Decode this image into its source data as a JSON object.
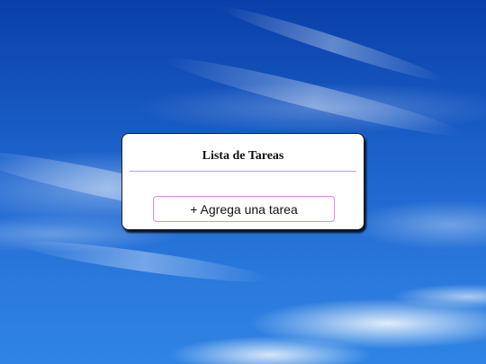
{
  "card": {
    "title": "Lista de Tareas",
    "add_button_label": "+ Agrega una tarea"
  },
  "colors": {
    "sky_top": "#0a3fa8",
    "sky_bottom": "#2f84e3",
    "accent_border": "#e08ae0",
    "card_background": "#ffffff"
  }
}
